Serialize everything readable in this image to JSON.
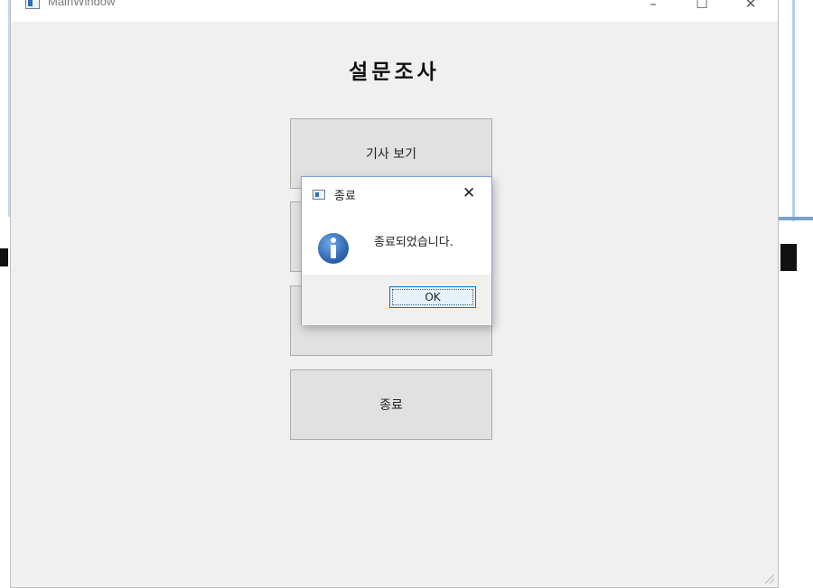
{
  "window": {
    "title": "MainWindow",
    "controls": {
      "minimize": "–",
      "maximize": "☐",
      "close": "✕"
    }
  },
  "main": {
    "heading": "설문조사",
    "buttons": [
      {
        "label": "기사 보기"
      },
      {
        "label": ""
      },
      {
        "label": ""
      },
      {
        "label": "종료"
      }
    ]
  },
  "dialog": {
    "title": "종료",
    "close_glyph": "✕",
    "icon": "information-icon",
    "message": "종료되었습니다.",
    "ok_label": "OK"
  },
  "colors": {
    "window_bg": "#f0f0f0",
    "button_bg": "#e1e1e1",
    "dialog_border": "#7ea4d6",
    "ok_border": "#0078d7",
    "info_icon": "#1f5fb3"
  }
}
